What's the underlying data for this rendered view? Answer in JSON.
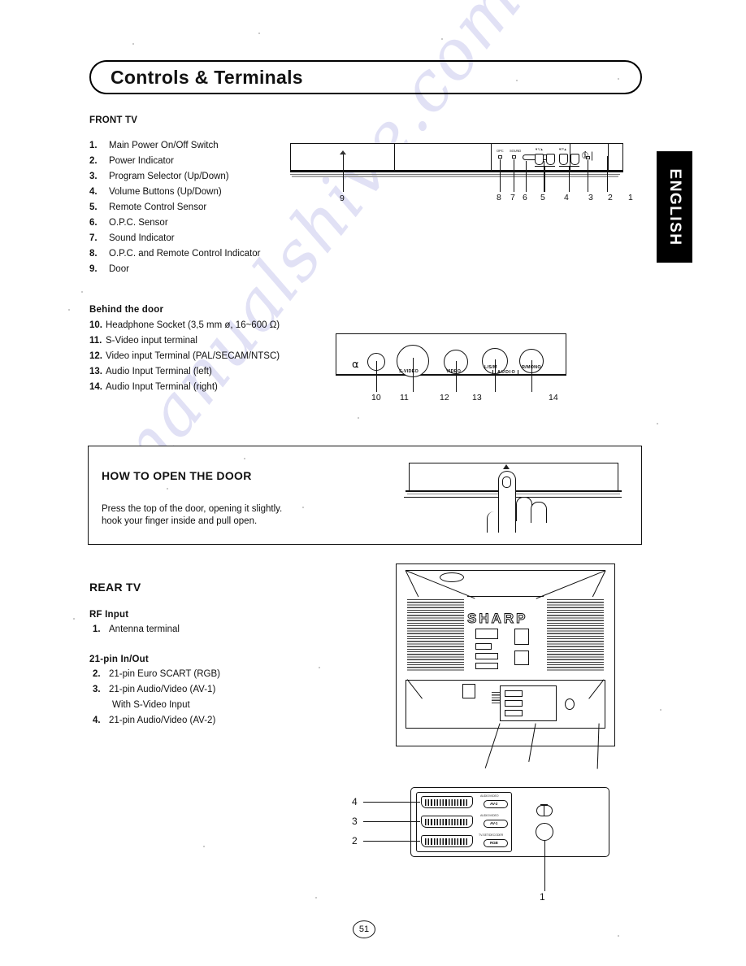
{
  "page": {
    "title": "Controls & Terminals",
    "side_tab": "ENGLISH",
    "page_number": "51",
    "watermark": "manualshive.com"
  },
  "front_tv": {
    "heading": "FRONT TV",
    "items": [
      {
        "num": "1.",
        "label": "Main Power On/Off Switch"
      },
      {
        "num": "2.",
        "label": "Power Indicator"
      },
      {
        "num": "3.",
        "label": "Program Selector (Up/Down)"
      },
      {
        "num": "4.",
        "label": "Volume Buttons (Up/Down)"
      },
      {
        "num": "5.",
        "label": "Remote Control Sensor"
      },
      {
        "num": "6.",
        "label": "O.P.C. Sensor"
      },
      {
        "num": "7.",
        "label": "Sound Indicator"
      },
      {
        "num": "8.",
        "label": "O.P.C. and Remote Control Indicator"
      },
      {
        "num": "9.",
        "label": "Door"
      }
    ],
    "diagram": {
      "callouts": [
        "8",
        "7",
        "6",
        "5",
        "4",
        "3",
        "2",
        "1"
      ],
      "door_callout": "9",
      "power_symbol": "①❘",
      "mini_labels": [
        "OPC",
        "SOUND",
        "▼V▲",
        "▼P▲",
        "●"
      ]
    }
  },
  "behind_door": {
    "heading": "Behind the door",
    "items": [
      {
        "num": "10.",
        "label": "Headphone Socket (3,5 mm ø, 16~600 Ω)"
      },
      {
        "num": "11.",
        "label": "S-Video input terminal"
      },
      {
        "num": "12.",
        "label": "Video input Terminal (PAL/SECAM/NTSC)"
      },
      {
        "num": "13.",
        "label": "Audio Input Terminal (left)"
      },
      {
        "num": "14.",
        "label": "Audio Input Terminal (right)"
      }
    ],
    "diagram": {
      "callouts": [
        "10",
        "11",
        "12",
        "13",
        "14"
      ],
      "jack_labels": [
        "S-VIDEO",
        "VIDEO",
        "L/S/M",
        "R/MONO"
      ],
      "audio_bracket": "AUDIO",
      "headphone_icon": "headphone-icon"
    }
  },
  "how_to_open": {
    "title": "HOW TO OPEN THE DOOR",
    "body_line1": "Press the top of the door, opening it slightly.",
    "body_line2": "hook your finger inside and pull open."
  },
  "rear_tv": {
    "heading": "REAR TV",
    "groups": [
      {
        "subheading": "RF Input",
        "items": [
          {
            "num": "1.",
            "label": "Antenna terminal"
          }
        ]
      },
      {
        "subheading": "21-pin In/Out",
        "items": [
          {
            "num": "2.",
            "label": "21-pin Euro SCART (RGB)"
          },
          {
            "num": "3.",
            "label": "21-pin Audio/Video (AV-1)"
          },
          {
            "num": "",
            "label": "With S-Video Input"
          },
          {
            "num": "4.",
            "label": "21-pin Audio/Video (AV-2)"
          }
        ]
      }
    ],
    "diagram": {
      "brand": "SHARP",
      "callouts": [
        "4",
        "3",
        "2",
        "1"
      ],
      "connector_tags": [
        "AV-2",
        "AV-1",
        "RGB"
      ],
      "connector_tiny": [
        "AUDIO/VIDEO",
        "AUDIO/VIDEO",
        "TV-SET/DECODER"
      ]
    }
  }
}
